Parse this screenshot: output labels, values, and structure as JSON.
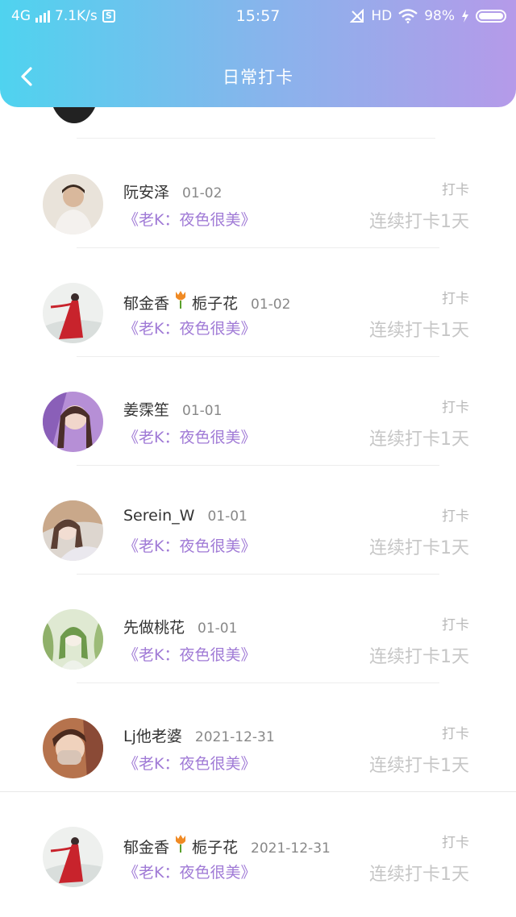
{
  "status_bar": {
    "network": "4G",
    "speed": "7.1K/s",
    "time": "15:57",
    "hd": "HD",
    "battery": "98%"
  },
  "header": {
    "title": "日常打卡"
  },
  "entries": [
    {
      "name": "阮安泽",
      "date": "01-02",
      "book": "《老K：夜色很美》",
      "action": "打卡",
      "streak": "连续打卡1天"
    },
    {
      "name": "郁金香",
      "name_suffix": "栀子花",
      "date": "01-02",
      "book": "《老K：夜色很美》",
      "action": "打卡",
      "streak": "连续打卡1天"
    },
    {
      "name": "姜霂笙",
      "date": "01-01",
      "book": "《老K：夜色很美》",
      "action": "打卡",
      "streak": "连续打卡1天"
    },
    {
      "name": "Serein_W",
      "date": "01-01",
      "book": "《老K：夜色很美》",
      "action": "打卡",
      "streak": "连续打卡1天"
    },
    {
      "name": "先做桃花",
      "date": "01-01",
      "book": "《老K：夜色很美》",
      "action": "打卡",
      "streak": "连续打卡1天"
    },
    {
      "name": "Lj他老婆",
      "date": "2021-12-31",
      "book": "《老K：夜色很美》",
      "action": "打卡",
      "streak": "连续打卡1天"
    },
    {
      "name": "郁金香",
      "name_suffix": "栀子花",
      "date": "2021-12-31",
      "book": "《老K：夜色很美》",
      "action": "打卡",
      "streak": "连续打卡1天"
    }
  ]
}
